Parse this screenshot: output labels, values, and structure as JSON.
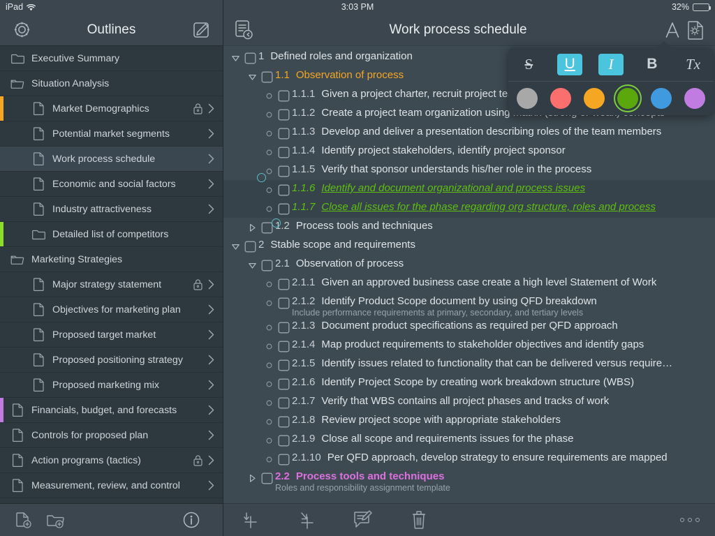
{
  "statusbar": {
    "device_label": "iPad",
    "wifi_icon": "wifi-icon",
    "time": "3:03 PM",
    "battery_percent": "32%",
    "battery_level": 32
  },
  "sidebar": {
    "header": {
      "settings_icon": "gear-icon",
      "title": "Outlines",
      "compose_icon": "compose-icon"
    },
    "items": [
      {
        "label": "Executive Summary",
        "type": "folder",
        "indent": 0,
        "flag": "",
        "locked": false,
        "chevron": false,
        "selected": false
      },
      {
        "label": "Situation Analysis",
        "type": "folder-open",
        "indent": 0,
        "flag": "",
        "locked": false,
        "chevron": false,
        "selected": false
      },
      {
        "label": "Market Demographics",
        "type": "document",
        "indent": 1,
        "flag": "#f5a623",
        "locked": true,
        "chevron": true,
        "selected": false
      },
      {
        "label": "Potential market segments",
        "type": "document",
        "indent": 1,
        "flag": "",
        "locked": false,
        "chevron": true,
        "selected": false
      },
      {
        "label": "Work process schedule",
        "type": "document",
        "indent": 1,
        "flag": "",
        "locked": false,
        "chevron": true,
        "selected": true
      },
      {
        "label": "Economic and social factors",
        "type": "document",
        "indent": 1,
        "flag": "",
        "locked": false,
        "chevron": true,
        "selected": false
      },
      {
        "label": "Industry attractiveness",
        "type": "document",
        "indent": 1,
        "flag": "",
        "locked": false,
        "chevron": true,
        "selected": false
      },
      {
        "label": "Detailed list of competitors",
        "type": "folder",
        "indent": 1,
        "flag": "#8ddb2a",
        "locked": false,
        "chevron": false,
        "selected": false
      },
      {
        "label": "Marketing Strategies",
        "type": "folder-open",
        "indent": 0,
        "flag": "",
        "locked": false,
        "chevron": false,
        "selected": false
      },
      {
        "label": "Major strategy statement",
        "type": "document",
        "indent": 1,
        "flag": "",
        "locked": true,
        "chevron": true,
        "selected": false
      },
      {
        "label": "Objectives for marketing plan",
        "type": "document",
        "indent": 1,
        "flag": "",
        "locked": false,
        "chevron": true,
        "selected": false
      },
      {
        "label": "Proposed target market",
        "type": "document",
        "indent": 1,
        "flag": "",
        "locked": false,
        "chevron": true,
        "selected": false
      },
      {
        "label": "Proposed positioning strategy",
        "type": "document",
        "indent": 1,
        "flag": "",
        "locked": false,
        "chevron": true,
        "selected": false
      },
      {
        "label": "Proposed marketing mix",
        "type": "document",
        "indent": 1,
        "flag": "",
        "locked": false,
        "chevron": true,
        "selected": false
      },
      {
        "label": "Financials, budget, and forecasts",
        "type": "document",
        "indent": 0,
        "flag": "#c07ce0",
        "locked": false,
        "chevron": true,
        "selected": false
      },
      {
        "label": "Controls for proposed plan",
        "type": "document",
        "indent": 0,
        "flag": "",
        "locked": false,
        "chevron": true,
        "selected": false
      },
      {
        "label": "Action programs (tactics)",
        "type": "document",
        "indent": 0,
        "flag": "",
        "locked": true,
        "chevron": true,
        "selected": false
      },
      {
        "label": "Measurement, review, and control",
        "type": "document",
        "indent": 0,
        "flag": "",
        "locked": false,
        "chevron": true,
        "selected": false
      }
    ],
    "footer": {
      "new_document_icon": "new-document-icon",
      "new_folder_icon": "new-folder-icon",
      "info_icon": "info-icon"
    }
  },
  "main": {
    "header": {
      "back_icon": "document-back-icon",
      "title": "Work process schedule",
      "font_icon": "font-format-icon",
      "settings_icon": "document-settings-icon"
    },
    "rows": [
      {
        "number": "1",
        "text": "Defined roles and organization",
        "indent": 0,
        "marker": "triangle-down",
        "color": "",
        "note": "",
        "selected": false
      },
      {
        "number": "1.1",
        "text": "Observation of process",
        "indent": 1,
        "marker": "triangle-down",
        "color": "orange",
        "note": "",
        "selected": false
      },
      {
        "number": "1.1.1",
        "text": "Given a project charter, recruit project team",
        "indent": 2,
        "marker": "bullet",
        "color": "",
        "note": "",
        "selected": false
      },
      {
        "number": "1.1.2",
        "text": "Create a project team organization using matrix (strong or weak) concepts",
        "indent": 2,
        "marker": "bullet",
        "color": "",
        "note": "",
        "selected": false
      },
      {
        "number": "1.1.3",
        "text": "Develop and deliver a presentation describing roles of the team members",
        "indent": 2,
        "marker": "bullet",
        "color": "",
        "note": "",
        "selected": false
      },
      {
        "number": "1.1.4",
        "text": "Identify project stakeholders, identify project sponsor",
        "indent": 2,
        "marker": "bullet",
        "color": "",
        "note": "",
        "selected": false
      },
      {
        "number": "1.1.5",
        "text": "Verify that sponsor understands his/her role in the process",
        "indent": 2,
        "marker": "bullet",
        "color": "",
        "note": "",
        "selected": false
      },
      {
        "number": "1.1.6",
        "text": "Identify and document organizational and process issues",
        "indent": 2,
        "marker": "bullet",
        "color": "green",
        "note": "",
        "selected": true
      },
      {
        "number": "1.1.7",
        "text": "Close all issues for the phase regarding org structure, roles and process",
        "indent": 2,
        "marker": "bullet",
        "color": "green",
        "note": "",
        "selected": true
      },
      {
        "number": "1.2",
        "text": "Process tools and techniques",
        "indent": 1,
        "marker": "triangle-right",
        "color": "",
        "note": "",
        "selected": false
      },
      {
        "number": "2",
        "text": "Stable scope and requirements",
        "indent": 0,
        "marker": "triangle-down",
        "color": "",
        "note": "",
        "selected": false
      },
      {
        "number": "2.1",
        "text": "Observation of process",
        "indent": 1,
        "marker": "triangle-down",
        "color": "",
        "note": "",
        "selected": false
      },
      {
        "number": "2.1.1",
        "text": "Given an approved business case create a high level Statement of Work",
        "indent": 2,
        "marker": "bullet",
        "color": "",
        "note": "",
        "selected": false
      },
      {
        "number": "2.1.2",
        "text": "Identify Product Scope document by using QFD breakdown",
        "indent": 2,
        "marker": "bullet",
        "color": "",
        "note": "Include performance requirements at primary, secondary, and tertiary levels",
        "selected": false
      },
      {
        "number": "2.1.3",
        "text": "Document product specifications as required per QFD approach",
        "indent": 2,
        "marker": "bullet",
        "color": "",
        "note": "",
        "selected": false
      },
      {
        "number": "2.1.4",
        "text": "Map product requirements to stakeholder objectives and identify gaps",
        "indent": 2,
        "marker": "bullet",
        "color": "",
        "note": "",
        "selected": false
      },
      {
        "number": "2.1.5",
        "text": "Identify issues related to functionality that can be delivered versus require…",
        "indent": 2,
        "marker": "bullet",
        "color": "",
        "note": "",
        "selected": false
      },
      {
        "number": "2.1.6",
        "text": "Identify Project Scope by creating work breakdown structure (WBS)",
        "indent": 2,
        "marker": "bullet",
        "color": "",
        "note": "",
        "selected": false
      },
      {
        "number": "2.1.7",
        "text": "Verify that WBS contains all project phases and tracks of work",
        "indent": 2,
        "marker": "bullet",
        "color": "",
        "note": "",
        "selected": false
      },
      {
        "number": "2.1.8",
        "text": "Review project scope with appropriate stakeholders",
        "indent": 2,
        "marker": "bullet",
        "color": "",
        "note": "",
        "selected": false
      },
      {
        "number": "2.1.9",
        "text": "Close all scope and requirements issues for the phase",
        "indent": 2,
        "marker": "bullet",
        "color": "",
        "note": "",
        "selected": false
      },
      {
        "number": "2.1.10",
        "text": "Per QFD approach, develop strategy to ensure requirements are mapped",
        "indent": 2,
        "marker": "bullet",
        "color": "",
        "note": "",
        "selected": false
      },
      {
        "number": "2.2",
        "text": "Process tools and techniques",
        "indent": 1,
        "marker": "triangle-right",
        "color": "pink",
        "note": "Roles and responsibility assignment template",
        "selected": false
      }
    ],
    "footer": {
      "add_sibling_icon": "add-sibling-row-icon",
      "add_child_icon": "add-child-row-icon",
      "note_icon": "edit-note-icon",
      "delete_icon": "trash-icon",
      "more_icon": "more-options-icon"
    }
  },
  "format_popup": {
    "styles": [
      {
        "label": "S",
        "name": "strikethrough",
        "active": false
      },
      {
        "label": "U",
        "name": "underline",
        "active": true
      },
      {
        "label": "I",
        "name": "italic",
        "active": true
      },
      {
        "label": "B",
        "name": "bold",
        "active": false
      },
      {
        "label": "Tx",
        "name": "clear-formatting",
        "active": false
      }
    ],
    "colors": [
      {
        "hex": "#a8a8a8",
        "name": "gray",
        "active": false
      },
      {
        "hex": "#fc6f6f",
        "name": "red",
        "active": false
      },
      {
        "hex": "#f5a623",
        "name": "orange",
        "active": false
      },
      {
        "hex": "#5aa80c",
        "name": "green",
        "active": true
      },
      {
        "hex": "#3f9ae0",
        "name": "blue",
        "active": false
      },
      {
        "hex": "#c07ce0",
        "name": "purple",
        "active": false
      }
    ],
    "active_accent": "#4bc5de"
  }
}
